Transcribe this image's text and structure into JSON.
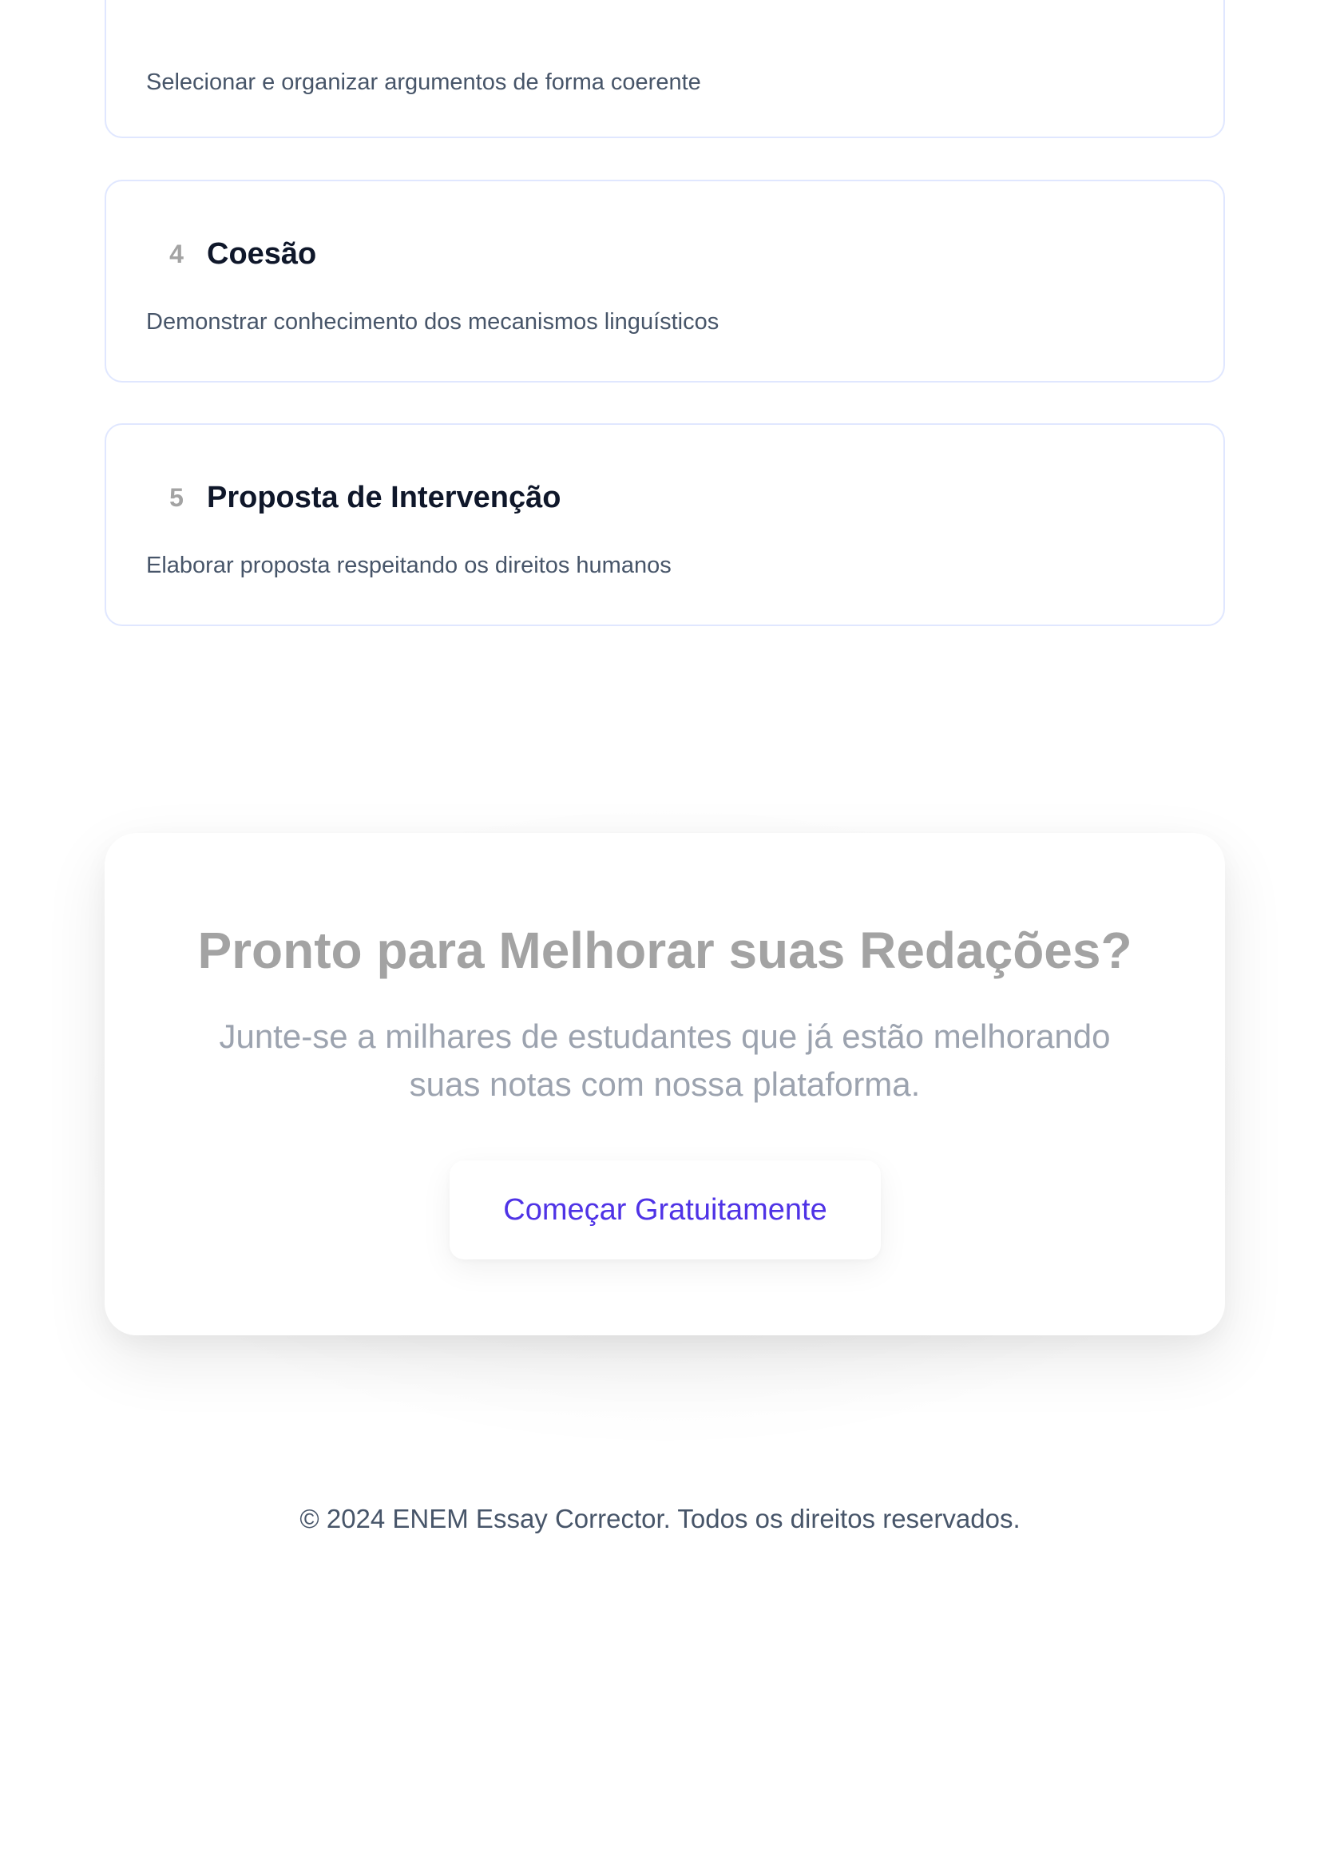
{
  "competencies": [
    {
      "number": "",
      "title": "",
      "description": "Selecionar e organizar argumentos de forma coerente"
    },
    {
      "number": "4",
      "title": "Coesão",
      "description": "Demonstrar conhecimento dos mecanismos linguísticos"
    },
    {
      "number": "5",
      "title": "Proposta de Intervenção",
      "description": "Elaborar proposta respeitando os direitos humanos"
    }
  ],
  "cta": {
    "title": "Pronto para Melhorar suas Redações?",
    "subtitle": "Junte-se a milhares de estudantes que já estão melhorando suas notas com nossa plataforma.",
    "button_label": "Começar Gratuitamente"
  },
  "footer": {
    "copyright": "© 2024 ENEM Essay Corrector. Todos os direitos reservados."
  },
  "colors": {
    "accent": "#4f33e6",
    "card_border": "#e0e7ff",
    "heading": "#0f172a",
    "muted": "#a3a3a3"
  }
}
